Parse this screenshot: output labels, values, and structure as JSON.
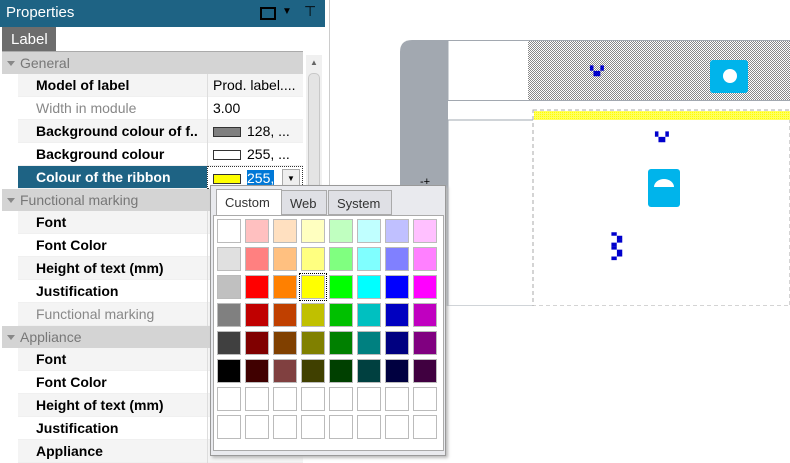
{
  "panel": {
    "title": "Properties",
    "tab": "Label"
  },
  "sections": [
    {
      "label": "General",
      "rows": [
        {
          "name": "Model of label",
          "value": "Prod. label...."
        },
        {
          "name": "Width in module",
          "value": "3.00",
          "dim": true
        },
        {
          "name": "Background colour of f..",
          "value": "128, ...",
          "swatch": "#808080"
        },
        {
          "name": "Background colour",
          "value": "255, ...",
          "swatch": "#ffffff"
        },
        {
          "name": "Colour of the ribbon",
          "value": "255,",
          "swatch": "#ffff00",
          "selected": true
        }
      ]
    },
    {
      "label": "Functional marking",
      "rows": [
        {
          "name": "Font",
          "value": ""
        },
        {
          "name": "Font Color",
          "value": ""
        },
        {
          "name": "Height of text (mm)",
          "value": ""
        },
        {
          "name": "Justification",
          "value": ""
        },
        {
          "name": "Functional marking",
          "value": "",
          "dim": true
        }
      ]
    },
    {
      "label": "Appliance",
      "rows": [
        {
          "name": "Font",
          "value": ""
        },
        {
          "name": "Font Color",
          "value": ""
        },
        {
          "name": "Height of text (mm)",
          "value": ""
        },
        {
          "name": "Justification",
          "value": ""
        },
        {
          "name": "Appliance",
          "value": ""
        }
      ]
    }
  ],
  "color_picker": {
    "tabs": [
      "Custom",
      "Web",
      "System"
    ],
    "active_tab": "Custom",
    "selected": "#ffff00",
    "colors": [
      [
        "#ffffff",
        "#ffc0c0",
        "#ffe0c0",
        "#ffffc0",
        "#c0ffc0",
        "#c0ffff",
        "#c0c0ff",
        "#ffc0ff"
      ],
      [
        "#e0e0e0",
        "#ff8080",
        "#ffc080",
        "#ffff80",
        "#80ff80",
        "#80ffff",
        "#8080ff",
        "#ff80ff"
      ],
      [
        "#c0c0c0",
        "#ff0000",
        "#ff8000",
        "#ffff00",
        "#00ff00",
        "#00ffff",
        "#0000ff",
        "#ff00ff"
      ],
      [
        "#808080",
        "#c00000",
        "#c04000",
        "#c0c000",
        "#00c000",
        "#00c0c0",
        "#0000c0",
        "#c000c0"
      ],
      [
        "#404040",
        "#800000",
        "#804000",
        "#808000",
        "#008000",
        "#008080",
        "#000080",
        "#800080"
      ],
      [
        "#000000",
        "#400000",
        "#804040",
        "#404000",
        "#004000",
        "#004040",
        "#000040",
        "#400040"
      ],
      [
        "#ffffff",
        "#ffffff",
        "#ffffff",
        "#ffffff",
        "#ffffff",
        "#ffffff",
        "#ffffff",
        "#ffffff"
      ],
      [
        "#ffffff",
        "#ffffff",
        "#ffffff",
        "#ffffff",
        "#ffffff",
        "#ffffff",
        "#ffffff",
        "#ffffff"
      ]
    ]
  },
  "colors": {
    "accent": "#1e6384",
    "icon": "#00b4eb",
    "ribbon": "#ffff00"
  }
}
